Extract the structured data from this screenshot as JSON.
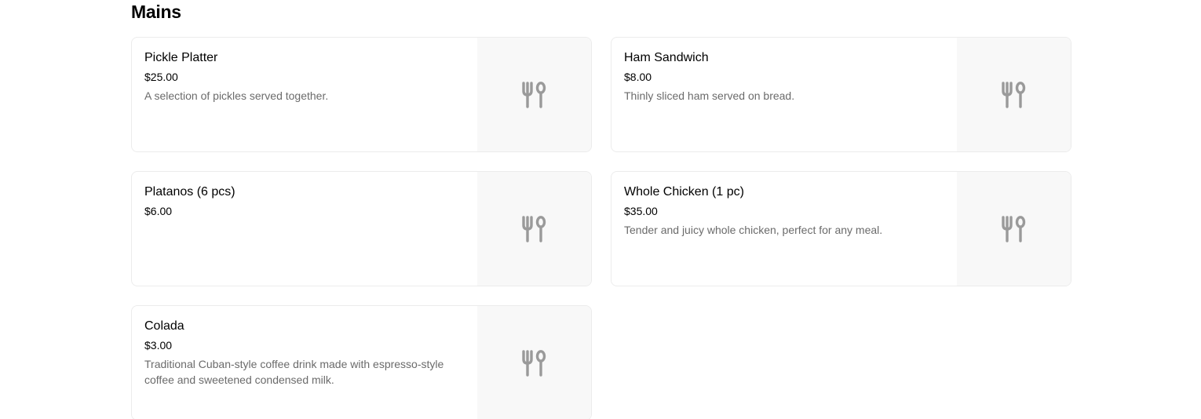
{
  "section": {
    "title": "Mains"
  },
  "items": [
    {
      "name": "Pickle Platter",
      "price": "$25.00",
      "description": "A selection of pickles served together.",
      "icon": "utensils-icon"
    },
    {
      "name": "Ham Sandwich",
      "price": "$8.00",
      "description": "Thinly sliced ham served on bread.",
      "icon": "utensils-icon"
    },
    {
      "name": "Platanos (6 pcs)",
      "price": "$6.00",
      "description": "",
      "icon": "utensils-icon"
    },
    {
      "name": "Whole Chicken (1 pc)",
      "price": "$35.00",
      "description": "Tender and juicy whole chicken, perfect for any meal.",
      "icon": "utensils-icon"
    },
    {
      "name": "Colada",
      "price": "$3.00",
      "description": "Traditional Cuban-style coffee drink made with espresso-style coffee and sweetened condensed milk.",
      "icon": "utensils-icon"
    }
  ],
  "colors": {
    "placeholder_bg": "#f8f8f8",
    "icon": "#9a9a9a",
    "description_text": "#6b6b6b",
    "card_border": "#ececec"
  }
}
